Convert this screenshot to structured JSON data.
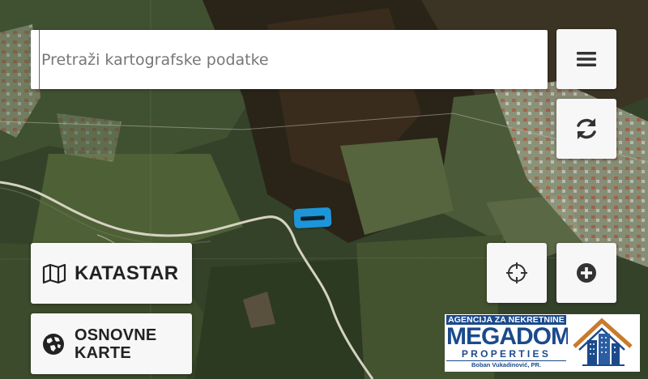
{
  "search": {
    "placeholder": "Pretraži kartografske podatke",
    "value": ""
  },
  "buttons": {
    "katastar_label": "KATASTAR",
    "osnovne_karte_label": "OSNOVNE KARTE"
  },
  "icons": {
    "menu": "hamburger-menu-icon",
    "refresh": "refresh-icon",
    "locate": "crosshair-icon",
    "zoom_in": "plus-circle-icon",
    "katastar": "map-icon",
    "osnovne": "globe-icon"
  },
  "logo": {
    "line1": "AGENCIJA ZA NEKRETNINE",
    "line2": "MEGADOM",
    "line3": "PROPERTIES",
    "line4": "Boban Vukadinović, PR."
  },
  "colors": {
    "marker": "#1d95d8",
    "logo_blue": "#1b4a8c",
    "logo_gold": "#c97a2a",
    "button_bg": "#f7f7f7"
  }
}
